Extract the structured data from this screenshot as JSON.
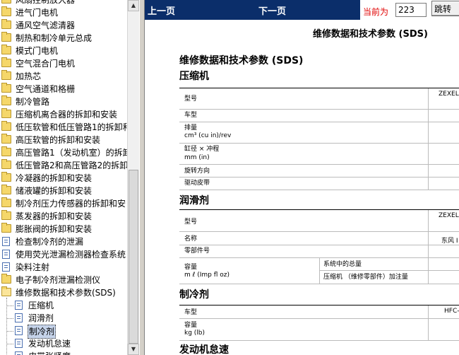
{
  "tree": {
    "items": [
      {
        "label": "风扇控制放大器",
        "type": "folder"
      },
      {
        "label": "进气门电机",
        "type": "folder"
      },
      {
        "label": "通风空气滤清器",
        "type": "folder"
      },
      {
        "label": "制热和制冷单元总成",
        "type": "folder"
      },
      {
        "label": "模式门电机",
        "type": "folder"
      },
      {
        "label": "空气混合门电机",
        "type": "folder"
      },
      {
        "label": "加热芯",
        "type": "folder"
      },
      {
        "label": "空气通道和格栅",
        "type": "folder"
      },
      {
        "label": "制冷管路",
        "type": "folder"
      },
      {
        "label": "压缩机离合器的拆卸和安装",
        "type": "folder"
      },
      {
        "label": "低压软管和低压管路1的拆卸和",
        "type": "folder"
      },
      {
        "label": "高压软管的拆卸和安装",
        "type": "folder"
      },
      {
        "label": "高压管路1（发动机室）的拆卸",
        "type": "folder"
      },
      {
        "label": "低压管路2和高压管路2的拆卸",
        "type": "folder"
      },
      {
        "label": "冷凝器的拆卸和安装",
        "type": "folder"
      },
      {
        "label": "储液罐的拆卸和安装",
        "type": "folder"
      },
      {
        "label": "制冷剂压力传感器的拆卸和安",
        "type": "folder"
      },
      {
        "label": "蒸发器的拆卸和安装",
        "type": "folder"
      },
      {
        "label": "膨胀阀的拆卸和安装",
        "type": "folder"
      },
      {
        "label": "检查制冷剂的泄漏",
        "type": "doc"
      },
      {
        "label": "使用荧光泄漏检测器检查系统",
        "type": "doc"
      },
      {
        "label": "染料注射",
        "type": "doc"
      },
      {
        "label": "电子制冷剂泄漏检测仪",
        "type": "folder"
      },
      {
        "label": "维修数据和技术参数(SDS)",
        "type": "folder-open"
      },
      {
        "label": "压缩机",
        "type": "doc",
        "child": true
      },
      {
        "label": "润滑剂",
        "type": "doc",
        "child": true
      },
      {
        "label": "制冷剂",
        "type": "doc",
        "child": true,
        "selected": true
      },
      {
        "label": "发动机怠速",
        "type": "doc",
        "child": true
      },
      {
        "label": "皮带张紧度",
        "type": "doc",
        "child": true
      }
    ]
  },
  "nav": {
    "prev": "上一页",
    "next": "下一页",
    "current_label": "当前为",
    "page_value": "223",
    "jump": "跳转"
  },
  "doc": {
    "title": "维修数据和技术参数 (SDS)",
    "heading": "维修数据和技术参数 (SDS)",
    "compressor": {
      "title": "压缩机",
      "rows": [
        {
          "label": "型号",
          "value": "ZEXEL"
        },
        {
          "label": "车型",
          "value": ""
        },
        {
          "label": "排量",
          "label2": "cm³ (cu in)/rev",
          "value": ""
        },
        {
          "label": "缸径 × 冲程",
          "label2": "mm (in)",
          "value": ""
        },
        {
          "label": "旋转方向",
          "value": ""
        },
        {
          "label": "驱动皮带",
          "value": ""
        }
      ]
    },
    "lubricant": {
      "title": "润滑剂",
      "rows": [
        {
          "label": "型号",
          "value": "ZEXEL"
        },
        {
          "label": "名称",
          "value": "东风 I"
        },
        {
          "label": "零部件号",
          "value": ""
        }
      ],
      "capacity_label": "容量",
      "capacity_unit": "m ℓ (Imp fl oz)",
      "capacity_sub1": "系统中的总量",
      "capacity_sub2": "压缩机 （维修零部件）加注量"
    },
    "refrigerant": {
      "title": "制冷剂",
      "type_label": "车型",
      "type_value": "HFC-",
      "capacity_label": "容量",
      "capacity_unit": "kg (lb)"
    },
    "idle": {
      "title": "发动机怠速"
    }
  }
}
